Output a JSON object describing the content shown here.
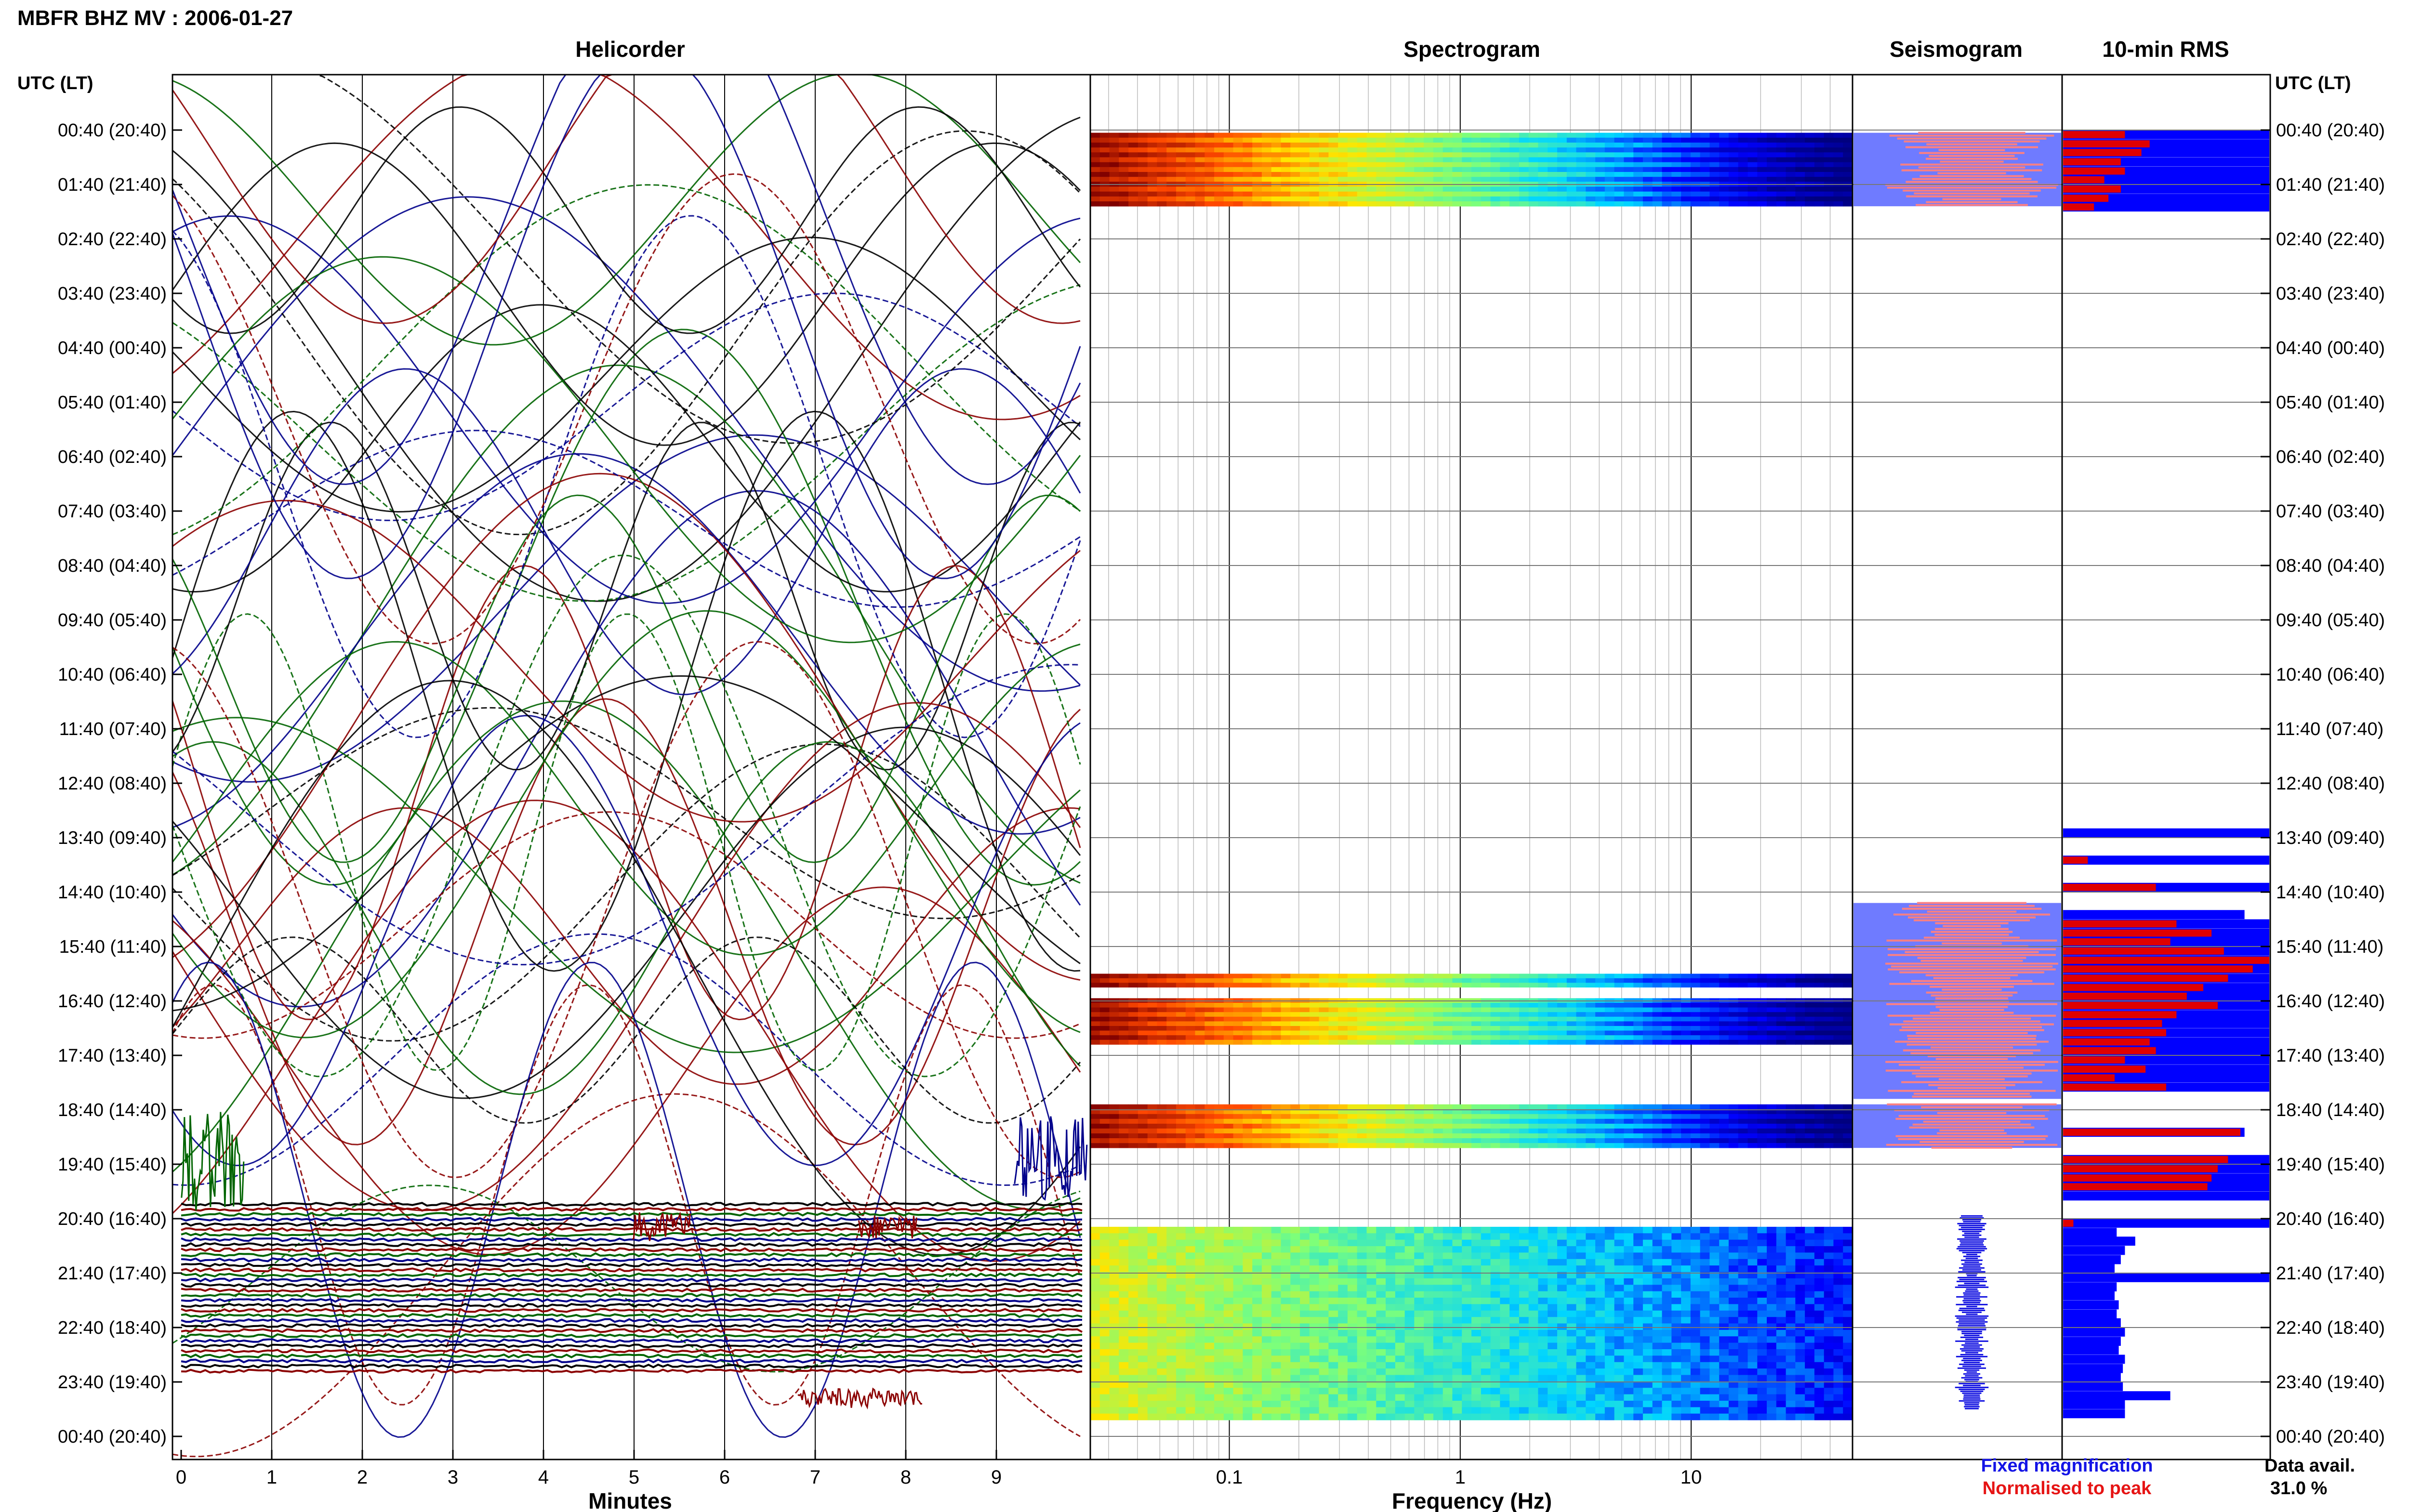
{
  "page_title": "MBFR BHZ MV : 2006-01-27",
  "panels": {
    "helicorder": "Helicorder",
    "spectrogram": "Spectrogram",
    "seismogram": "Seismogram",
    "rms": "10-min RMS"
  },
  "axis_headers": {
    "left": "UTC (LT)",
    "right": "UTC (LT)"
  },
  "xlabels": {
    "minutes": "Minutes",
    "frequency": "Frequency (Hz)"
  },
  "legend": {
    "fixed": "Fixed magnification",
    "normalised": "Normalised to peak",
    "fixed_color": "#1414e6",
    "normalised_color": "#e61414"
  },
  "data_avail": {
    "label": "Data avail.",
    "value": "31.0 %"
  },
  "chart_data": [
    {
      "type": "line",
      "title": "Helicorder",
      "xlabel": "Minutes",
      "xlim": [
        0,
        10
      ],
      "x_ticks": [
        "0",
        "1",
        "2",
        "3",
        "4",
        "5",
        "6",
        "7",
        "8",
        "9"
      ],
      "rows": [
        "00:40 (20:40)",
        "01:40 (21:40)",
        "02:40 (22:40)",
        "03:40 (23:40)",
        "04:40 (00:40)",
        "05:40 (01:40)",
        "06:40 (02:40)",
        "07:40 (03:40)",
        "08:40 (04:40)",
        "09:40 (05:40)",
        "10:40 (06:40)",
        "11:40 (07:40)",
        "12:40 (08:40)",
        "13:40 (09:40)",
        "14:40 (10:40)",
        "15:40 (11:40)",
        "16:40 (12:40)",
        "17:40 (13:40)",
        "18:40 (14:40)",
        "19:40 (15:40)",
        "20:40 (16:40)",
        "21:40 (17:40)",
        "22:40 (18:40)",
        "23:40 (19:40)",
        "00:40 (20:40)"
      ],
      "trace_colors": [
        "#000000",
        "#8b0000",
        "#006400",
        "#00008b"
      ]
    },
    {
      "type": "heatmap",
      "title": "Spectrogram",
      "xlabel": "Frequency (Hz)",
      "x_scale": "log",
      "xlim": [
        0.025,
        50
      ],
      "x_ticks": [
        {
          "value": 0.1,
          "label": "0.1"
        },
        {
          "value": 1,
          "label": "1"
        },
        {
          "value": 10,
          "label": "10"
        }
      ],
      "active_time_blocks": [
        [
          0.05,
          1.4
        ],
        [
          15.5,
          15.75
        ],
        [
          15.95,
          16.8
        ],
        [
          17.9,
          18.7
        ],
        [
          20.15,
          23.7
        ]
      ],
      "colormap": [
        "#00007f",
        "#0000ff",
        "#00d5ff",
        "#7dff7a",
        "#ffe600",
        "#ff4800",
        "#7f0000"
      ]
    },
    {
      "type": "line",
      "title": "Seismogram",
      "segments": [
        {
          "start": 0.05,
          "end": 1.4,
          "style": "saturated"
        },
        {
          "start": 14.2,
          "end": 17.8,
          "style": "saturated"
        },
        {
          "start": 17.9,
          "end": 18.7,
          "style": "saturated"
        },
        {
          "start": 19.95,
          "end": 23.5,
          "style": "narrow"
        }
      ]
    },
    {
      "type": "bar",
      "title": "10-min RMS",
      "series": [
        {
          "name": "Fixed magnification",
          "color": "#0000ff"
        },
        {
          "name": "Normalised to peak",
          "color": "#e00000"
        }
      ],
      "bars": [
        {
          "t": 0.0,
          "fixed": 1.0,
          "norm": 0.3
        },
        {
          "t": 0.17,
          "fixed": 1.0,
          "norm": 0.42
        },
        {
          "t": 0.33,
          "fixed": 1.0,
          "norm": 0.38
        },
        {
          "t": 0.5,
          "fixed": 1.0,
          "norm": 0.28
        },
        {
          "t": 0.67,
          "fixed": 1.0,
          "norm": 0.3
        },
        {
          "t": 0.83,
          "fixed": 1.0,
          "norm": 0.2
        },
        {
          "t": 1.0,
          "fixed": 1.0,
          "norm": 0.28
        },
        {
          "t": 1.17,
          "fixed": 1.0,
          "norm": 0.22
        },
        {
          "t": 1.33,
          "fixed": 1.0,
          "norm": 0.15
        },
        {
          "t": 12.83,
          "fixed": 1.0,
          "norm": 0.0
        },
        {
          "t": 13.33,
          "fixed": 1.0,
          "norm": 0.12
        },
        {
          "t": 13.83,
          "fixed": 1.0,
          "norm": 0.45
        },
        {
          "t": 14.33,
          "fixed": 0.88,
          "norm": 0.0
        },
        {
          "t": 14.5,
          "fixed": 1.0,
          "norm": 0.55
        },
        {
          "t": 14.67,
          "fixed": 1.0,
          "norm": 0.72
        },
        {
          "t": 14.83,
          "fixed": 1.0,
          "norm": 0.52
        },
        {
          "t": 15.0,
          "fixed": 1.0,
          "norm": 0.78
        },
        {
          "t": 15.17,
          "fixed": 1.0,
          "norm": 1.0
        },
        {
          "t": 15.33,
          "fixed": 1.0,
          "norm": 0.92
        },
        {
          "t": 15.5,
          "fixed": 1.0,
          "norm": 0.8
        },
        {
          "t": 15.67,
          "fixed": 1.0,
          "norm": 0.68
        },
        {
          "t": 15.83,
          "fixed": 1.0,
          "norm": 0.6
        },
        {
          "t": 16.0,
          "fixed": 1.0,
          "norm": 0.75
        },
        {
          "t": 16.17,
          "fixed": 1.0,
          "norm": 0.55
        },
        {
          "t": 16.33,
          "fixed": 1.0,
          "norm": 0.48
        },
        {
          "t": 16.5,
          "fixed": 1.0,
          "norm": 0.5
        },
        {
          "t": 16.67,
          "fixed": 1.0,
          "norm": 0.42
        },
        {
          "t": 16.83,
          "fixed": 1.0,
          "norm": 0.45
        },
        {
          "t": 17.0,
          "fixed": 1.0,
          "norm": 0.3
        },
        {
          "t": 17.17,
          "fixed": 1.0,
          "norm": 0.4
        },
        {
          "t": 17.33,
          "fixed": 1.0,
          "norm": 0.25
        },
        {
          "t": 17.5,
          "fixed": 1.0,
          "norm": 0.5
        },
        {
          "t": 18.33,
          "fixed": 0.88,
          "norm": 0.86
        },
        {
          "t": 18.83,
          "fixed": 1.0,
          "norm": 0.8
        },
        {
          "t": 19.0,
          "fixed": 1.0,
          "norm": 0.75
        },
        {
          "t": 19.17,
          "fixed": 1.0,
          "norm": 0.72
        },
        {
          "t": 19.33,
          "fixed": 1.0,
          "norm": 0.7
        },
        {
          "t": 19.5,
          "fixed": 1.0,
          "norm": 0.0
        },
        {
          "t": 20.0,
          "fixed": 1.0,
          "norm": 0.05
        },
        {
          "t": 20.17,
          "fixed": 0.26,
          "norm": 0.0
        },
        {
          "t": 20.33,
          "fixed": 0.35,
          "norm": 0.0
        },
        {
          "t": 20.5,
          "fixed": 0.3,
          "norm": 0.0
        },
        {
          "t": 20.67,
          "fixed": 0.28,
          "norm": 0.0
        },
        {
          "t": 20.83,
          "fixed": 0.25,
          "norm": 0.0
        },
        {
          "t": 21.0,
          "fixed": 1.0,
          "norm": 0.0
        },
        {
          "t": 21.17,
          "fixed": 0.26,
          "norm": 0.0
        },
        {
          "t": 21.33,
          "fixed": 0.25,
          "norm": 0.0
        },
        {
          "t": 21.5,
          "fixed": 0.27,
          "norm": 0.0
        },
        {
          "t": 21.67,
          "fixed": 0.26,
          "norm": 0.0
        },
        {
          "t": 21.83,
          "fixed": 0.28,
          "norm": 0.0
        },
        {
          "t": 22.0,
          "fixed": 0.3,
          "norm": 0.0
        },
        {
          "t": 22.17,
          "fixed": 0.28,
          "norm": 0.0
        },
        {
          "t": 22.33,
          "fixed": 0.27,
          "norm": 0.0
        },
        {
          "t": 22.5,
          "fixed": 0.3,
          "norm": 0.0
        },
        {
          "t": 22.67,
          "fixed": 0.29,
          "norm": 0.0
        },
        {
          "t": 22.83,
          "fixed": 0.28,
          "norm": 0.0
        },
        {
          "t": 23.0,
          "fixed": 0.29,
          "norm": 0.0
        },
        {
          "t": 23.17,
          "fixed": 0.52,
          "norm": 0.0
        },
        {
          "t": 23.33,
          "fixed": 0.3,
          "norm": 0.0
        },
        {
          "t": 23.5,
          "fixed": 0.3,
          "norm": 0.0
        }
      ]
    }
  ]
}
